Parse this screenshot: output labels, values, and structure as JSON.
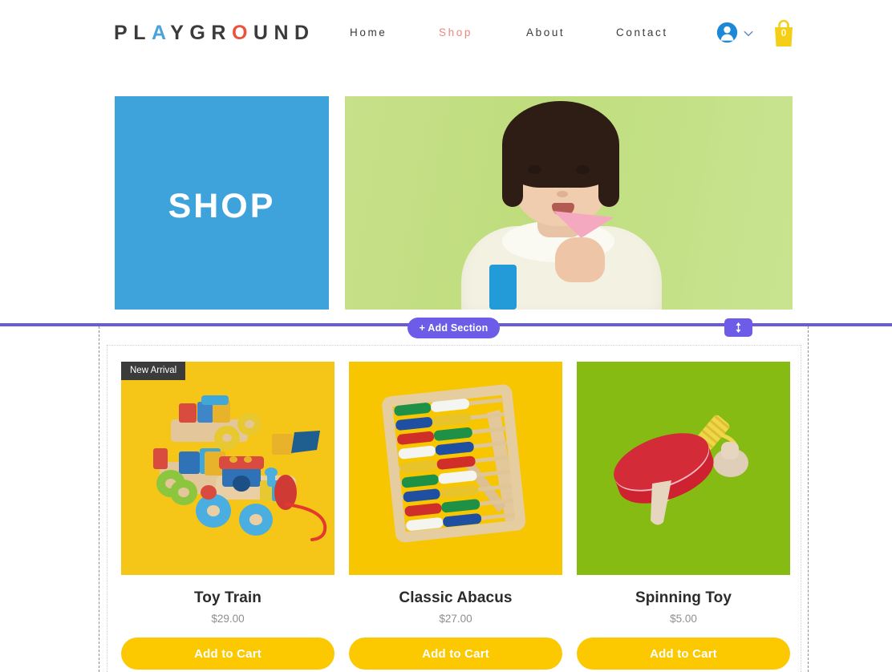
{
  "header": {
    "logo": {
      "full_text": "PLAYGROUND",
      "letters": [
        "P",
        "L",
        "A",
        "Y",
        "G",
        "R",
        "O",
        "U",
        "N",
        "D"
      ],
      "accent_a_color": "#4aa3dd",
      "accent_o_color": "#e8553c",
      "base_color": "#3b3b3b"
    },
    "nav": [
      {
        "label": "Home",
        "active": false
      },
      {
        "label": "Shop",
        "active": true
      },
      {
        "label": "About",
        "active": false
      },
      {
        "label": "Contact",
        "active": false
      }
    ],
    "active_nav_color": "#e88a7d",
    "account": {
      "icon": "user-avatar-icon",
      "menu_icon": "chevron-down-icon"
    },
    "cart": {
      "icon": "shopping-bag-icon",
      "count": "0",
      "color": "#f5cf15"
    }
  },
  "hero": {
    "banner": {
      "title": "SHOP",
      "background_color": "#3fa3db",
      "text_color": "#ffffff"
    },
    "photo": {
      "alt": "young child holding a pink triangular block",
      "background_color": "#c4df86"
    }
  },
  "editor": {
    "add_section_label": "+ Add Section",
    "add_section_color": "#6d5ce7",
    "divider_color": "#6a5cd6",
    "resize_handle_icon": "vertical-resize-arrow-icon",
    "guide_color": "#8d8d8d"
  },
  "products": [
    {
      "name": "Toy Train",
      "price": "$29.00",
      "badge": "New Arrival",
      "button_label": "Add to Cart",
      "image_bg": "#f5c518",
      "image_alt": "wooden toy train with colorful blocks"
    },
    {
      "name": "Classic Abacus",
      "price": "$27.00",
      "badge": "",
      "button_label": "Add to Cart",
      "image_bg": "#f7c600",
      "image_alt": "wooden abacus with colored beads"
    },
    {
      "name": "Spinning Toy",
      "price": "$5.00",
      "badge": "",
      "button_label": "Add to Cart",
      "image_bg": "#85bb12",
      "image_alt": "red wooden spinning top with string"
    }
  ],
  "colors": {
    "button_yellow": "#fcc800",
    "badge_dark": "#3b3b3b",
    "price_gray": "#8e8e8e",
    "title_dark": "#2b2b2b"
  }
}
